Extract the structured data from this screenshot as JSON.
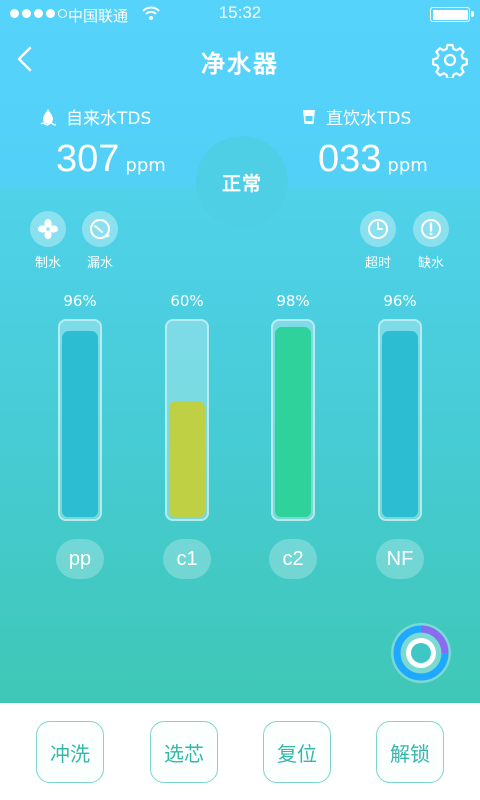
{
  "status_bar": {
    "carrier": "中国联通",
    "time": "15:32"
  },
  "header": {
    "title": "净水器"
  },
  "tds": {
    "tap": {
      "label": "自来水TDS",
      "value": "307",
      "unit": "ppm"
    },
    "direct": {
      "label": "直饮水TDS",
      "value": "033",
      "unit": "ppm"
    },
    "status": "正常"
  },
  "indicators": {
    "making": "制水",
    "leak": "漏水",
    "timeout": "超时",
    "shortage": "缺水"
  },
  "filters": [
    {
      "name": "pp",
      "percent": 96,
      "percent_label": "96%",
      "color": "#2dbdd3"
    },
    {
      "name": "c1",
      "percent": 60,
      "percent_label": "60%",
      "color": "#bfd044"
    },
    {
      "name": "c2",
      "percent": 98,
      "percent_label": "98%",
      "color": "#30d29b"
    },
    {
      "name": "NF",
      "percent": 96,
      "percent_label": "96%",
      "color": "#2dbdd3"
    }
  ],
  "actions": {
    "flush": "冲洗",
    "select_core": "选芯",
    "reset": "复位",
    "unlock": "解锁"
  }
}
